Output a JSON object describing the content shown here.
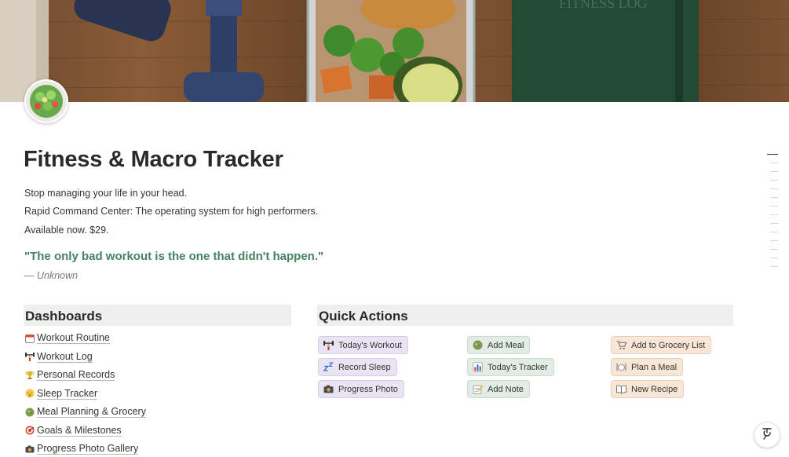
{
  "page": {
    "title": "Fitness & Macro Tracker",
    "paragraphs": [
      "Stop managing your life in your head.",
      "Rapid Command Center: The operating system for high performers.",
      "Available now. $29."
    ],
    "quote": "\"The only bad workout is the one that didn't happen.\"",
    "quote_author": "— Unknown",
    "cover_text": "FITNESS LOG"
  },
  "dashboards": {
    "heading": "Dashboards",
    "items": [
      {
        "label": "Workout Routine",
        "icon": "calendar-icon"
      },
      {
        "label": "Workout Log",
        "icon": "weightlifter-icon"
      },
      {
        "label": "Personal Records",
        "icon": "trophy-icon"
      },
      {
        "label": "Sleep Tracker",
        "icon": "sleeping-face-icon"
      },
      {
        "label": "Meal Planning & Grocery",
        "icon": "salad-icon"
      },
      {
        "label": "Goals & Milestones",
        "icon": "target-icon"
      },
      {
        "label": "Progress Photo Gallery",
        "icon": "camera-icon"
      }
    ]
  },
  "quick_actions": {
    "heading": "Quick Actions",
    "buttons": [
      {
        "label": "Today's Workout",
        "icon": "weightlifter-icon",
        "color": "#e8e4f3"
      },
      {
        "label": "Record Sleep",
        "icon": "zzz-icon",
        "color": "#e8e4f3"
      },
      {
        "label": "Progress Photo",
        "icon": "camera-icon",
        "color": "#e8e4f3"
      },
      {
        "label": "Add Meal",
        "icon": "salad-icon",
        "color": "#e2ede5"
      },
      {
        "label": "Today's Tracker",
        "icon": "bar-chart-icon",
        "color": "#e2ede5"
      },
      {
        "label": "Add Note",
        "icon": "memo-icon",
        "color": "#e2ede5"
      },
      {
        "label": "Add to Grocery List",
        "icon": "shopping-cart-icon",
        "color": "#f8e7d7"
      },
      {
        "label": "Plan a Meal",
        "icon": "fork-knife-plate-icon",
        "color": "#f8e7d7"
      },
      {
        "label": "New Recipe",
        "icon": "open-book-icon",
        "color": "#f8e7d7"
      }
    ]
  },
  "colors": {
    "quote_green": "#448361",
    "section_bg": "#efefed"
  }
}
